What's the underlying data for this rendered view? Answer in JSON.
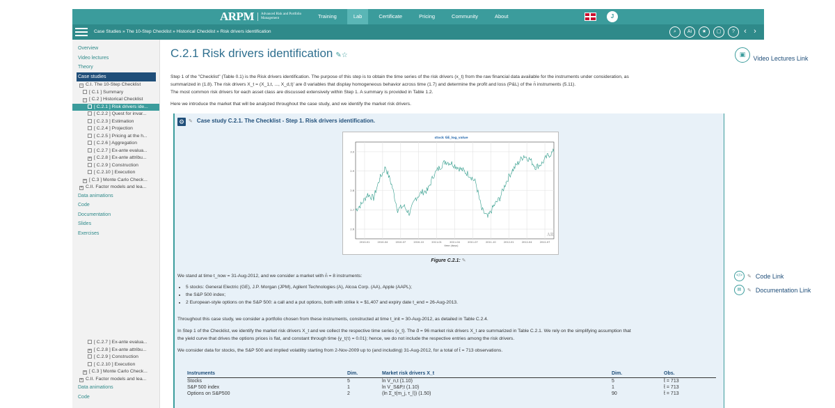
{
  "nav": {
    "logo": "ARPM",
    "logo_sub": "Advanced Risk and Portfolio Management",
    "items": [
      {
        "label": "Training",
        "active": false
      },
      {
        "label": "Lab",
        "active": true
      },
      {
        "label": "Certificate",
        "active": false
      },
      {
        "label": "Pricing",
        "active": false
      },
      {
        "label": "Community",
        "active": false
      },
      {
        "label": "About",
        "active": false
      }
    ],
    "user_initial": "J"
  },
  "breadcrumb": "Case Studies » The 10-Step Checklist » Historical Checklist » Risk drivers identification",
  "sidebar": {
    "top_links": [
      "Overview",
      "Video lectures",
      "Theory"
    ],
    "selected_link": "Case studies",
    "tree": [
      "C.I. The 10-Step Checklist",
      "[ C.1 ] Summary",
      "[ C.2 ] Historical Checklist",
      "[ C.2.1 ] Risk drivers ide...",
      "[ C.2.2 ] Quest for invar...",
      "[ C.2.3 ] Estimation",
      "[ C.2.4 ] Projection",
      "[ C.2.5 ] Pricing at the h...",
      "[ C.2.6 ] Aggregation",
      "[ C.2.7 ] Ex-ante evalua...",
      "[ C.2.8 ] Ex-ante attribu...",
      "[ C.2.9 ] Construction",
      "[ C.2.10 ] Execution",
      "[ C.3 ] Monte Carlo Check...",
      "C.II. Factor models and lea..."
    ],
    "bottom_links": [
      "Data animations",
      "Code",
      "Documentation",
      "Slides",
      "Exercises"
    ],
    "tree_repeat": [
      "[ C.2.7 ] Ex-ante evalua...",
      "[ C.2.8 ] Ex-ante attribu...",
      "[ C.2.9 ] Construction",
      "[ C.2.10 ] Execution",
      "[ C.3 ] Monte Carlo Check...",
      "C.II. Factor models and lea..."
    ],
    "bottom_links_repeat": [
      "Data animations",
      "Code"
    ]
  },
  "main": {
    "title": "C.2.1 Risk drivers identification",
    "intro_1": "Step 1 of the \"Checklist\" (Table 0.1) is the Risk drivers identification. The purpose of this step is to obtain the time series of the risk drivers (x_t) from the raw financial data available for the instruments under consideration, as",
    "intro_2": "summarized in (1.8). The risk drivers X_t = (X_1,t, ..., X_d,t)' are d̄ variables that display homogeneous behavior across time (1.7) and determine the profit and loss (P&L) of the n̄ instruments (5.11).",
    "intro_3": "The most common risk drivers for each asset class are discussed extensively within Step 1. A summary is provided in Table 1.2.",
    "intro_4": "Here we introduce the market that will be analyzed throughout the case study, and we identify the market risk drivers.",
    "case_title": "Case study C.2.1.  The Checklist - Step 1. Risk drivers identification.",
    "figure_caption": "Figure C.2.1:",
    "text_1": "We stand at time t_now = 31-Aug-2012, and we consider a market with n̄ = 8 instruments:",
    "bullets": [
      "5 stocks: General Electric (GE), J.P. Morgan (JPM), Agilent Technologies (A), Alcoa Corp. (AA), Apple (AAPL);",
      "the S&P 500 index;",
      "2 European-style options on the S&P 500: a call and a put options, both with strike k = $1,407 and expiry date t_end = 26-Aug-2013."
    ],
    "text_2": "Throughout this case study, we consider a portfolio chosen from these instruments, constructed at time t_init = 30-Aug-2012, as detailed in Table C.2.4.",
    "text_3": "In Step 1 of the Checklist, we identify the market risk drivers X_t and we collect the respective time series {x_t}. The d̄ = 96 market risk drivers X_t are summarized in Table C.2.1. We rely on the simplifying assumption that",
    "text_4": "the yield curve that drives the options prices is flat, and constant through time {y_t(τ) = 0.01}; hence, we do not include the respective entries among the risk drivers.",
    "text_5": "We consider data for stocks, the S&P 500 and implied volatility starting from 2-Nov-2009 up to (and including) 31-Aug-2012, for a total of t̄ = 713 observations.",
    "table": {
      "headers": [
        "Instruments",
        "Dim.",
        "Market risk drivers X_t",
        "Dim.",
        "Obs."
      ],
      "rows": [
        [
          "Stocks",
          "5",
          "ln V_n,t (1.10)",
          "5",
          "t̄ = 713"
        ],
        [
          "S&P 500 index",
          "1",
          "ln V_S&P,t (1.10)",
          "1",
          "t̄ = 713"
        ],
        [
          "Options on S&P500",
          "2",
          "(ln Σ_t(m_j, τ_l)) (1.50)",
          "90",
          "t̄ = 713"
        ]
      ]
    }
  },
  "chart_data": {
    "type": "line",
    "title": "stock GE_log_value",
    "xlabel": "time (days)",
    "x_ticks": [
      "2010-01",
      "2010-04",
      "2010-07",
      "2010-10",
      "2011-01",
      "2011-04",
      "2011-07",
      "2011-10",
      "2012-01",
      "2012-04",
      "2012-07"
    ],
    "y_ticks": [
      "2.6",
      "2.7",
      "2.8",
      "2.9",
      "3.0"
    ],
    "ylim": [
      2.55,
      3.05
    ],
    "series": [
      {
        "x": [
          "2009-11",
          "2009-12",
          "2010-01",
          "2010-02",
          "2010-03",
          "2010-04",
          "2010-05",
          "2010-06",
          "2010-07",
          "2010-08",
          "2010-09",
          "2010-10",
          "2010-11",
          "2010-12",
          "2011-01",
          "2011-02",
          "2011-03",
          "2011-04",
          "2011-05",
          "2011-06",
          "2011-07",
          "2011-08",
          "2011-09",
          "2011-10",
          "2011-11",
          "2011-12",
          "2012-01",
          "2012-02",
          "2012-03",
          "2012-04",
          "2012-05",
          "2012-06",
          "2012-07",
          "2012-08"
        ],
        "values": [
          2.7,
          2.73,
          2.78,
          2.76,
          2.86,
          2.92,
          2.83,
          2.7,
          2.72,
          2.68,
          2.76,
          2.79,
          2.8,
          2.88,
          2.92,
          2.95,
          2.94,
          2.92,
          2.9,
          2.88,
          2.84,
          2.7,
          2.66,
          2.72,
          2.76,
          2.84,
          2.9,
          2.94,
          2.98,
          2.96,
          2.92,
          2.94,
          2.98,
          3.0
        ]
      }
    ]
  },
  "right_links": {
    "video": "Video Lectures Link",
    "code": "Code Link",
    "documentation": "Documentation Link"
  },
  "colors": {
    "teal": "#3b9c9c",
    "navy": "#1f4e79",
    "panel": "#e8f1f8"
  }
}
